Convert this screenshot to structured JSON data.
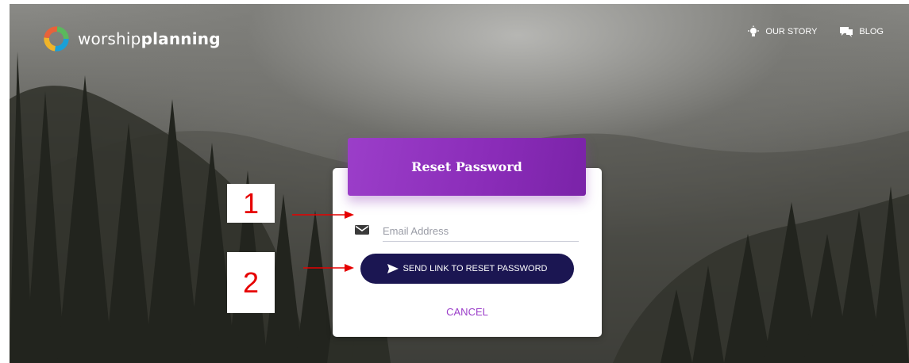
{
  "header": {
    "logo_text_light": "worship",
    "logo_text_bold": "planning",
    "nav": [
      {
        "label": "OUR STORY",
        "icon": "lightbulb-icon"
      },
      {
        "label": "BLOG",
        "icon": "chat-bubbles-icon"
      }
    ]
  },
  "form": {
    "title": "Reset Password",
    "email_placeholder": "Email Address",
    "email_value": "",
    "submit_label": "SEND LINK TO RESET PASSWORD",
    "submit_icon": "send-icon",
    "cancel_label": "CANCEL"
  },
  "annotations": {
    "step1": "1",
    "step2": "2"
  },
  "colors": {
    "header_purple": "#9b3ec9",
    "button_navy": "#1b1652",
    "cancel_purple": "#9b3ec9",
    "annotation_red": "#e60000"
  }
}
